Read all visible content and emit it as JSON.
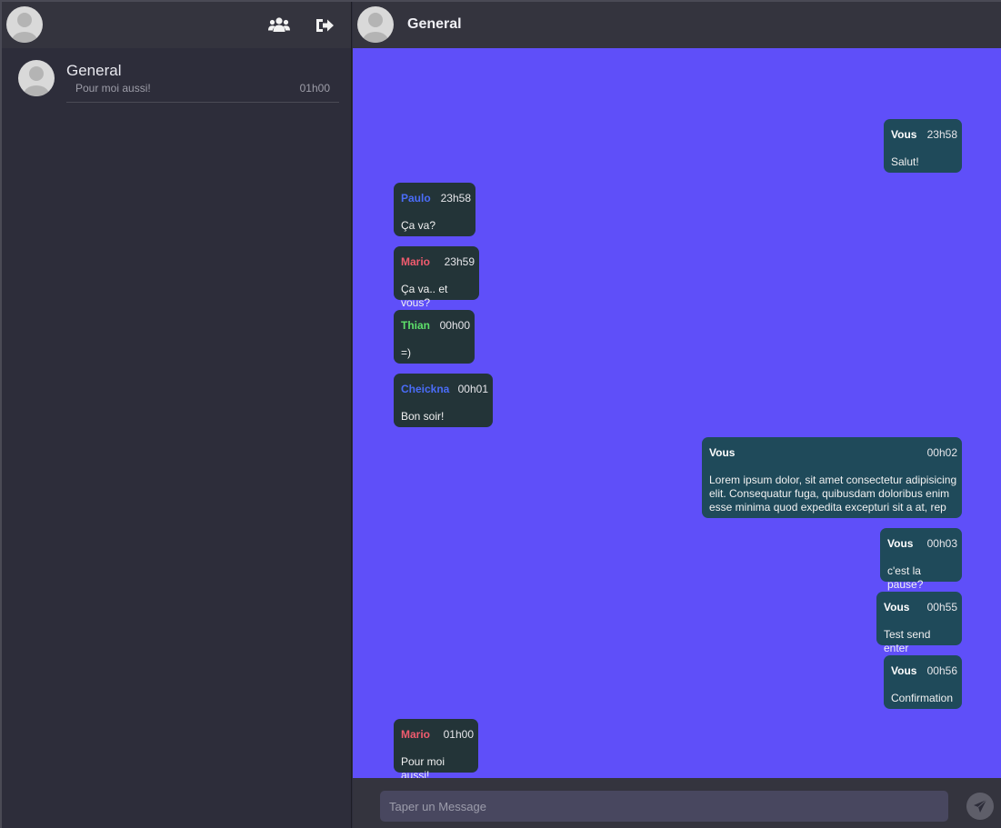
{
  "sidebar": {
    "conversations": [
      {
        "name": "General",
        "last_message": "Pour moi aussi!",
        "time": "01h00"
      }
    ]
  },
  "chat": {
    "title": "General",
    "messages": [
      {
        "author": "Vous",
        "time": "23h58",
        "text": "Salut!",
        "mine": true
      },
      {
        "author": "Paulo",
        "time": "23h58",
        "text": "Ça va?",
        "mine": false,
        "color": "#4a6cf7"
      },
      {
        "author": "Mario",
        "time": "23h59",
        "text": "Ça va.. et vous?",
        "mine": false,
        "color": "#f05b6e"
      },
      {
        "author": "Thian",
        "time": "00h00",
        "text": "=)",
        "mine": false,
        "color": "#5de06a"
      },
      {
        "author": "Cheickna",
        "time": "00h01",
        "text": "Bon soir!",
        "mine": false,
        "color": "#4a6cf7"
      },
      {
        "author": "Vous",
        "time": "00h02",
        "text": "Lorem ipsum dolor, sit amet consectetur adipisicing elit. Consequatur fuga, quibusdam doloribus enim esse minima quod expedita excepturi sit a at, rep",
        "mine": true
      },
      {
        "author": "Vous",
        "time": "00h03",
        "text": "c'est la pause?",
        "mine": true
      },
      {
        "author": "Vous",
        "time": "00h55",
        "text": "Test send enter",
        "mine": true
      },
      {
        "author": "Vous",
        "time": "00h56",
        "text": "Confirmation",
        "mine": true
      },
      {
        "author": "Mario",
        "time": "01h00",
        "text": "Pour moi aussi!",
        "mine": false,
        "color": "#f05b6e"
      }
    ]
  },
  "composer": {
    "placeholder": "Taper un Message"
  },
  "icons": {
    "users": "users-icon",
    "logout": "logout-icon",
    "send": "send-icon"
  },
  "colors": {
    "chat_background": "#5f4ff9",
    "panel": "#2d2d3a",
    "bubble_other": "#233438",
    "bubble_mine": "#1f4a5a"
  }
}
